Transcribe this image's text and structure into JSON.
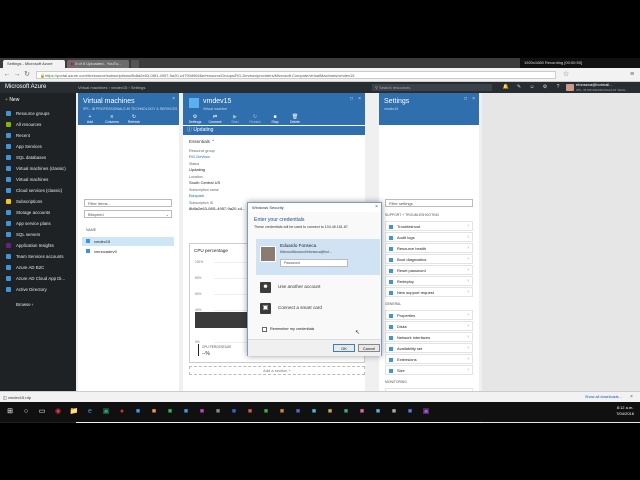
{
  "browser": {
    "tabs": [
      {
        "label": "Settings - Microsoft Azure"
      },
      {
        "label": "5 of 5 Uploaded - YouTu..."
      }
    ],
    "url_scheme": "https://",
    "url_host": "portal.azure.com",
    "url_rest": "/#resource/subscriptions/8b8a2e63-08f1-4957-9a20-c4790d9646e/resourceGroups/RG-Devbox/providers/Microsoft.Compute/virtualMachines/vmdev15",
    "recording": "1920x1080   Recording [00:00:50]"
  },
  "azure": {
    "brand": "Microsoft Azure",
    "breadcrumb": [
      "Virtual machines",
      "vmdev15",
      "Settings"
    ],
    "search_placeholder": "Search resources",
    "user_email": "efonseca@hotmail...",
    "user_dir": "IPS - IB PROFESSIONALS IN TECH..."
  },
  "leftnav": {
    "new_label": "New",
    "items": [
      {
        "label": "Resource groups",
        "color": "#3a96dd"
      },
      {
        "label": "All resources",
        "color": "#7fba00"
      },
      {
        "label": "Recent",
        "color": "#3a96dd"
      },
      {
        "label": "App Services",
        "color": "#3a96dd"
      },
      {
        "label": "SQL databases",
        "color": "#3a96dd"
      },
      {
        "label": "Virtual machines (classic)",
        "color": "#3a96dd"
      },
      {
        "label": "Virtual machines",
        "color": "#3a96dd"
      },
      {
        "label": "Cloud services (classic)",
        "color": "#3a96dd"
      },
      {
        "label": "Subscriptions",
        "color": "#f2c811"
      },
      {
        "label": "Storage accounts",
        "color": "#3a96dd"
      },
      {
        "label": "App service plans",
        "color": "#3a96dd"
      },
      {
        "label": "SQL servers",
        "color": "#3a96dd"
      },
      {
        "label": "Application Insights",
        "color": "#68217a"
      },
      {
        "label": "Team Services accounts",
        "color": "#3a96dd"
      },
      {
        "label": "Azure AD B2C",
        "color": "#3a96dd"
      },
      {
        "label": "Azure AD Cloud App Di...",
        "color": "#3a96dd"
      },
      {
        "label": "Active Directory",
        "color": "#3a96dd"
      }
    ],
    "browse_label": "Browse"
  },
  "vmlist": {
    "title": "Virtual machines",
    "subtitle": "IPS - IB PROFESSIONALS IN TECHNOLOGY & SERVICES",
    "toolbar": [
      "Add",
      "Columns",
      "Refresh"
    ],
    "filter_placeholder": "Filter items...",
    "dropdown": "Bitspeed",
    "column": "NAME",
    "rows": [
      "vmdev15",
      "vmnovadev9"
    ]
  },
  "vmblade": {
    "title": "vmdev15",
    "subtitle": "Virtual machine",
    "toolbar": [
      "Settings",
      "Connect",
      "Start",
      "Restart",
      "Stop",
      "Delete"
    ],
    "status_banner": "Updating",
    "essentials": "Essentials",
    "fields": [
      {
        "label": "Resource group",
        "value": "RG-Devbox"
      },
      {
        "label": "Status",
        "value": "Updating"
      },
      {
        "label": "Location",
        "value": "South Central US"
      },
      {
        "label": "Subscription name",
        "value": "Bizspark"
      },
      {
        "label": "Subscription ID",
        "value": "8b8a2e63-08f1-4957-9a20-c4..."
      }
    ],
    "chart_title": "CPU percentage",
    "chart_ticks": [
      "100%",
      "80%",
      "60%",
      "40%",
      "20%",
      "0%"
    ],
    "no_data": "No available data.",
    "legend_label": "CPU PERCENTAGE",
    "legend_value": "--%",
    "add_section": "Add a section +"
  },
  "settings": {
    "title": "Settings",
    "subtitle": "vmdev15",
    "filter_placeholder": "Filter settings",
    "group1": "SUPPORT + TROUBLESHOOTING",
    "items1": [
      "Troubleshoot",
      "Audit logs",
      "Resource health",
      "Boot diagnostics",
      "Reset password",
      "Redeploy",
      "New support request"
    ],
    "group2": "GENERAL",
    "items2": [
      "Properties",
      "Disks",
      "Network interfaces",
      "Availability set",
      "Extensions",
      "Size"
    ],
    "group3": "MONITORING",
    "items3": [
      "Alert rules",
      "Diagnostics"
    ]
  },
  "dialog": {
    "title": "Windows Security",
    "heading": "Enter your credentials",
    "subheading": "These credentials will be used to connect to 104.45.161.87.",
    "user_name": "Eduardo Fonseca",
    "user_account": "MicrosoftAccount\\efonseca@hot...",
    "password_placeholder": "Password",
    "other_account": "Use another account",
    "smart_card": "Connect a smart card",
    "remember": "Remember my credentials",
    "ok": "OK",
    "cancel": "Cancel"
  },
  "downloads": {
    "file": "vmdev15.rdp",
    "show_all": "Show all downloads..."
  },
  "taskbar": {
    "time": "8:12 a.m.",
    "date": "7/04/2016"
  }
}
